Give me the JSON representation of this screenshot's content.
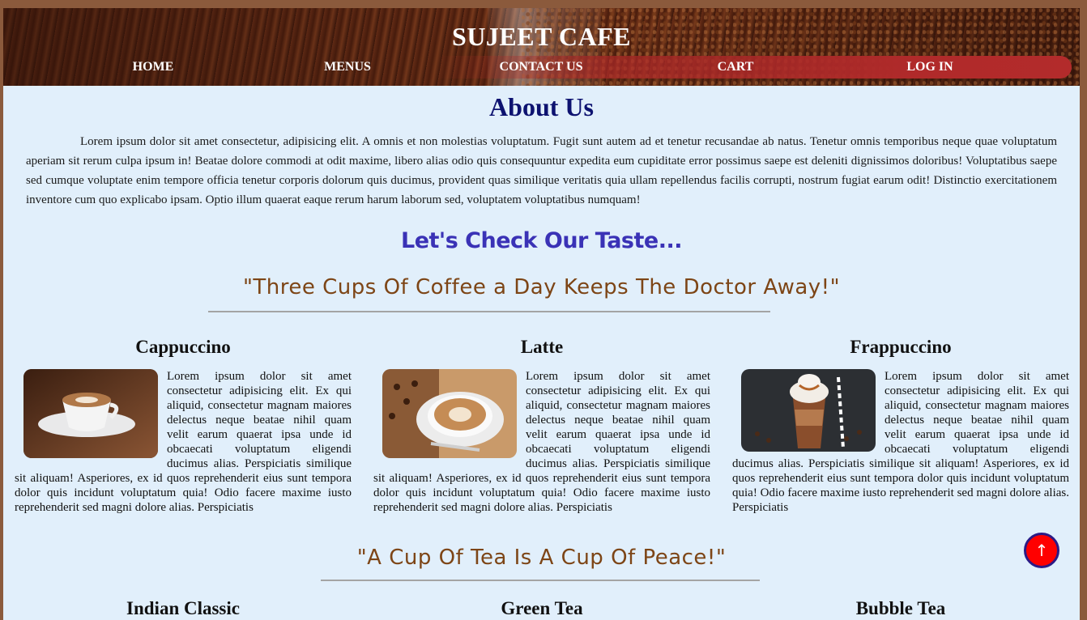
{
  "header": {
    "title": "SUJEET CAFE",
    "nav": [
      "HOME",
      "MENUS",
      "CONTACT US",
      "CART",
      "LOG IN"
    ]
  },
  "about": {
    "title": "About Us",
    "text": "Lorem ipsum dolor sit amet consectetur, adipisicing elit. A omnis et non molestias voluptatum. Fugit sunt autem ad et tenetur recusandae ab natus. Tenetur omnis temporibus neque quae voluptatum aperiam sit rerum culpa ipsum in! Beatae dolore commodi at odit maxime, libero alias odio quis consequuntur expedita eum cupiditate error possimus saepe est deleniti dignissimos doloribus! Voluptatibus saepe sed cumque voluptate enim tempore officia tenetur corporis dolorum quis ducimus, provident quas similique veritatis quia ullam repellendus facilis corrupti, nostrum fugiat earum odit! Distinctio exercitationem inventore cum quo explicabo ipsam. Optio illum quaerat eaque rerum harum laborum sed, voluptatem voluptatibus numquam!"
  },
  "taste_heading": "Let's Check Our Taste...",
  "coffee": {
    "quote": "\"Three Cups Of Coffee a Day Keeps The Doctor Away!\"",
    "items": [
      {
        "name": "Cappuccino",
        "icon": "cappuccino-image",
        "text": "Lorem ipsum dolor sit amet consectetur adipisicing elit. Ex qui aliquid, consectetur magnam maiores delectus neque beatae nihil quam velit earum quaerat ipsa unde id obcaecati voluptatum eligendi ducimus alias. Perspiciatis similique sit aliquam! Asperiores, ex id quos reprehenderit eius sunt tempora dolor quis incidunt voluptatum quia! Odio facere maxime iusto reprehenderit sed magni dolore alias. Perspiciatis"
      },
      {
        "name": "Latte",
        "icon": "latte-image",
        "text": "Lorem ipsum dolor sit amet consectetur adipisicing elit. Ex qui aliquid, consectetur magnam maiores delectus neque beatae nihil quam velit earum quaerat ipsa unde id obcaecati voluptatum eligendi ducimus alias. Perspiciatis similique sit aliquam! Asperiores, ex id quos reprehenderit eius sunt tempora dolor quis incidunt voluptatum quia! Odio facere maxime iusto reprehenderit sed magni dolore alias. Perspiciatis"
      },
      {
        "name": "Frappuccino",
        "icon": "frappuccino-image",
        "text": "Lorem ipsum dolor sit amet consectetur adipisicing elit. Ex qui aliquid, consectetur magnam maiores delectus neque beatae nihil quam velit earum quaerat ipsa unde id obcaecati voluptatum eligendi ducimus alias. Perspiciatis similique sit aliquam! Asperiores, ex id quos reprehenderit eius sunt tempora dolor quis incidunt voluptatum quia! Odio facere maxime iusto reprehenderit sed magni dolore alias. Perspiciatis"
      }
    ]
  },
  "tea": {
    "quote": "\"A Cup Of Tea Is A Cup Of Peace!\"",
    "items": [
      "Indian Classic",
      "Green Tea",
      "Bubble Tea"
    ]
  },
  "scroll_top": {
    "icon": "arrow-up-icon",
    "glyph": "↑"
  }
}
